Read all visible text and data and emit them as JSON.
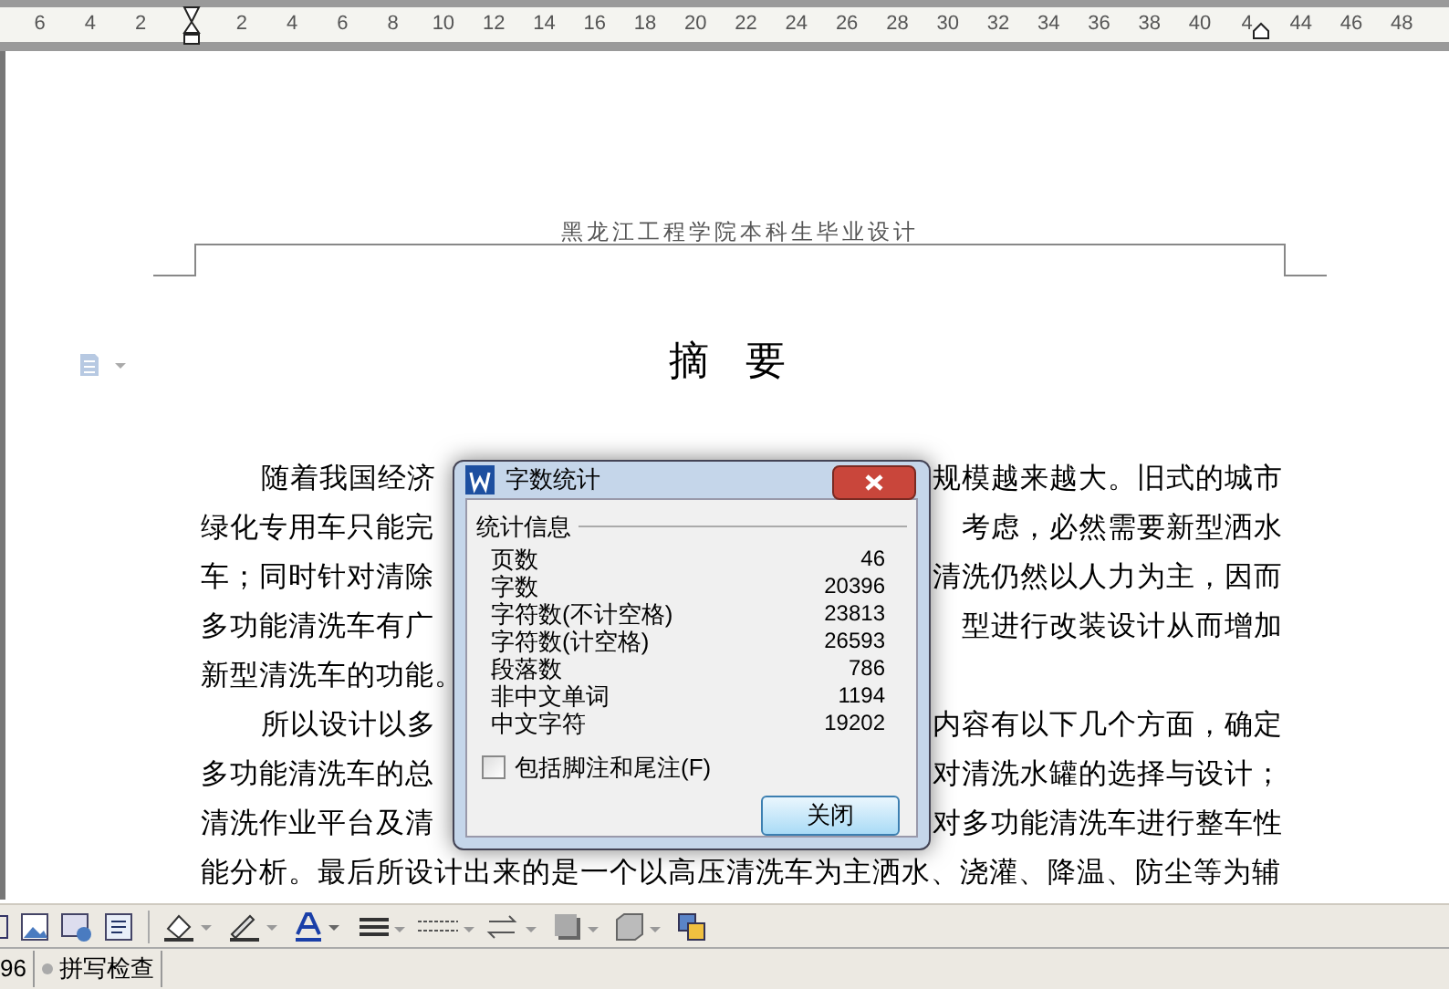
{
  "ruler": {
    "left_ticks": [
      "6",
      "4",
      "2"
    ],
    "right_ticks": [
      "2",
      "4",
      "6",
      "8",
      "10",
      "12",
      "14",
      "16",
      "18",
      "20",
      "22",
      "24",
      "26",
      "28",
      "30",
      "32",
      "34",
      "36",
      "38",
      "40",
      "4",
      "44",
      "46",
      "48"
    ]
  },
  "document": {
    "header": "黑龙江工程学院本科生毕业设计",
    "title": "摘 要",
    "lines": [
      {
        "indent": true,
        "left": "随着我国经济",
        "right": "规模越来越大。旧式的城市"
      },
      {
        "indent": false,
        "left": "绿化专用车只能完",
        "right": "考虑，必然需要新型洒水"
      },
      {
        "indent": false,
        "left": "车；同时针对清除",
        "right": "清洗仍然以人力为主，因而"
      },
      {
        "indent": false,
        "left": "多功能清洗车有广",
        "right": "型进行改装设计从而增加"
      },
      {
        "indent": false,
        "left": "新型清洗车的功能。"
      },
      {
        "indent": true,
        "left": "所以设计以多",
        "right": "内容有以下几个方面，确定"
      },
      {
        "indent": false,
        "left": "多功能清洗车的总",
        "right": "对清洗水罐的选择与设计；"
      },
      {
        "indent": false,
        "left": "清洗作业平台及清",
        "right": "对多功能清洗车进行整车性"
      },
      {
        "indent": false,
        "left": "能分析。最后所设计出来的是一个以高压清洗车为主洒水、浇灌、降温、防尘等为辅"
      }
    ]
  },
  "dialog": {
    "title": "字数统计",
    "group": "统计信息",
    "stats": [
      {
        "label": "页数",
        "value": "46"
      },
      {
        "label": "字数",
        "value": "20396"
      },
      {
        "label": "字符数(不计空格)",
        "value": "23813"
      },
      {
        "label": "字符数(计空格)",
        "value": "26593"
      },
      {
        "label": "段落数",
        "value": "786"
      },
      {
        "label": "非中文单词",
        "value": "1194"
      },
      {
        "label": "中文字符",
        "value": "19202"
      }
    ],
    "checkbox": {
      "label": "包括脚注和尾注(F)",
      "checked": false
    },
    "close_button": "关闭"
  },
  "status_bar": {
    "page": "96",
    "spell_check": "拼写检查"
  }
}
